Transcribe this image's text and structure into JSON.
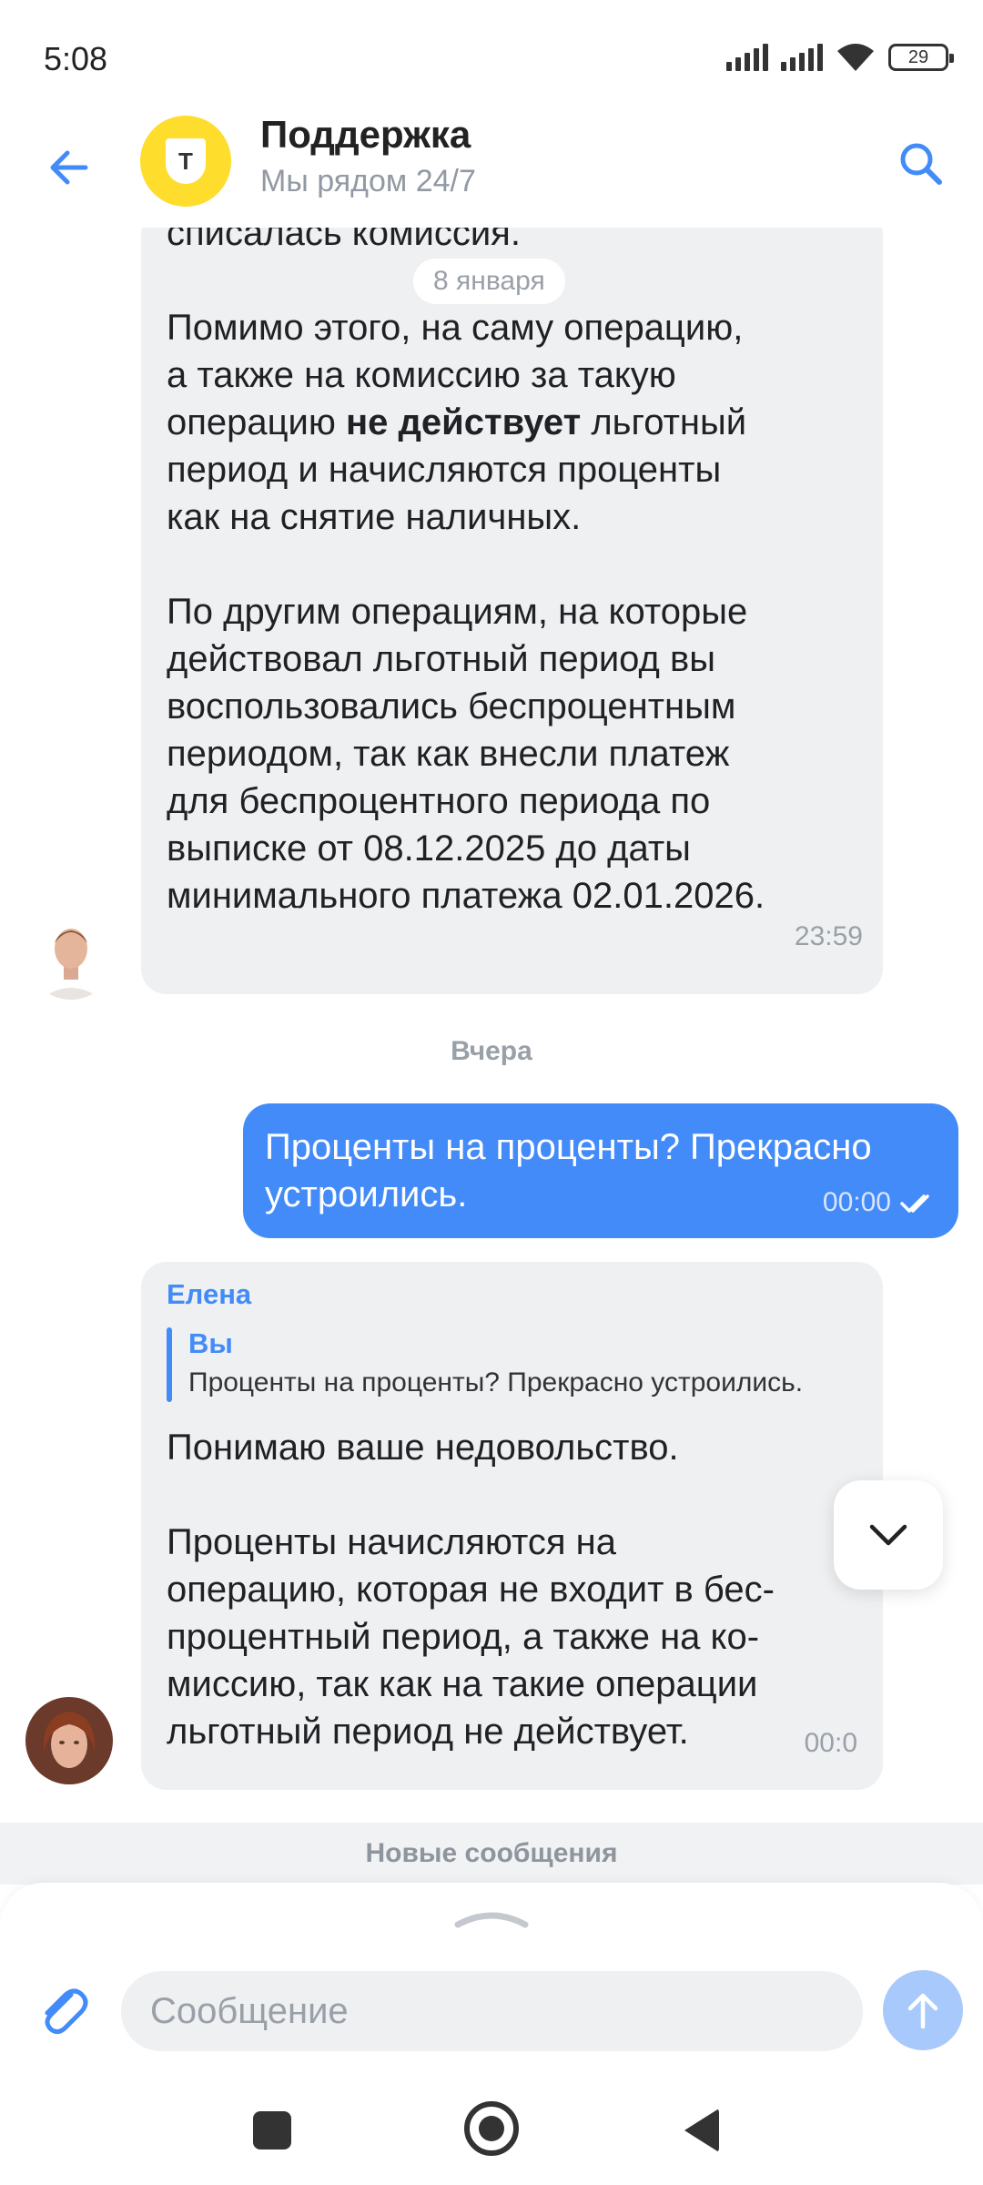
{
  "status_bar": {
    "time": "5:08",
    "battery": "29"
  },
  "header": {
    "title": "Поддержка",
    "subtitle": "Мы рядом 24/7",
    "logo_letter": "T"
  },
  "messages": {
    "top_partial": "списалась комиссия.",
    "date_pill": "8 января",
    "long_p1_before": "Помимо этого, на саму операцию,\nа также на комиссию за такую\nоперацию ",
    "long_p1_bold": "не действует",
    "long_p1_after": " льготный\nпериод и начисляются проценты\nкак на снятие наличных.",
    "long_p2": "По другим операциям, на которые\nдействовал льготный период вы\nвоспользовались беспроцентным\nпериодом, так как внесли платеж\nдля беспроцентного периода по\nвыписке от 08.12.2025 до даты\nминимального платежа 02.01.2026.",
    "long_time": "23:59",
    "day_label": "Вчера",
    "outgoing_text": "Проценты на проценты? Прекрасно\nустроились.",
    "outgoing_time": "00:00",
    "reply_sender": "Елена",
    "reply_quote_name": "Вы",
    "reply_quote_text": "Проценты на проценты? Прекрасно устроились.",
    "reply_p1": "Понимаю ваше недовольство.",
    "reply_p2": "Проценты начисляются на\nоперацию, которая не входит в бес-\nпроцентный период, а также на ко-\nмиссию, так как на такие операции\nльготный период не действует.",
    "reply_time": "00:0"
  },
  "new_messages_label": "Новые сообщения",
  "composer": {
    "placeholder": "Сообщение"
  },
  "colors": {
    "accent": "#428bf9",
    "bubble_in": "#eff0f2",
    "brand_yellow": "#ffdd2d"
  }
}
